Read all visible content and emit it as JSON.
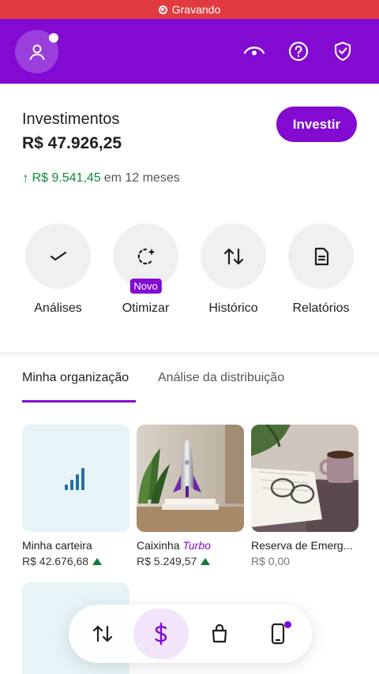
{
  "recording": {
    "label": "Gravando"
  },
  "header": {
    "avatar_icon": "user-icon",
    "icons": [
      "eye-icon",
      "help-icon",
      "shield-check-icon"
    ]
  },
  "summary": {
    "title": "Investimentos",
    "value": "R$ 47.926,25",
    "invest_button": "Investir",
    "growth_amount": "R$ 9.541,45",
    "growth_period": "em 12 meses"
  },
  "shortcuts": [
    {
      "label": "Análises",
      "icon": "trend-icon"
    },
    {
      "label": "Otimizar",
      "icon": "sparkle-refresh-icon",
      "badge": "Novo"
    },
    {
      "label": "Histórico",
      "icon": "transfer-arrows-icon"
    },
    {
      "label": "Relatórios",
      "icon": "document-icon"
    }
  ],
  "tabs": [
    {
      "label": "Minha organização",
      "active": true
    },
    {
      "label": "Análise da distribuição",
      "active": false
    }
  ],
  "cards": [
    {
      "name": "Minha carteira",
      "value": "R$ 42.676,68",
      "trend": "up"
    },
    {
      "name_prefix": "Caixinha ",
      "name_highlight": "Turbo",
      "value": "R$ 5.249,57",
      "trend": "up"
    },
    {
      "name": "Reserva de Emerg...",
      "value": "R$ 0,00",
      "trend": "none"
    }
  ],
  "bottom_nav": [
    {
      "icon": "transfer-arrows-icon",
      "active": false
    },
    {
      "icon": "dollar-icon",
      "active": true
    },
    {
      "icon": "shopping-bag-icon",
      "active": false
    },
    {
      "icon": "phone-icon",
      "active": false,
      "notification": true
    }
  ],
  "colors": {
    "brand": "#820ad1",
    "positive": "#0e8a3b",
    "recording": "#e03b3f"
  }
}
